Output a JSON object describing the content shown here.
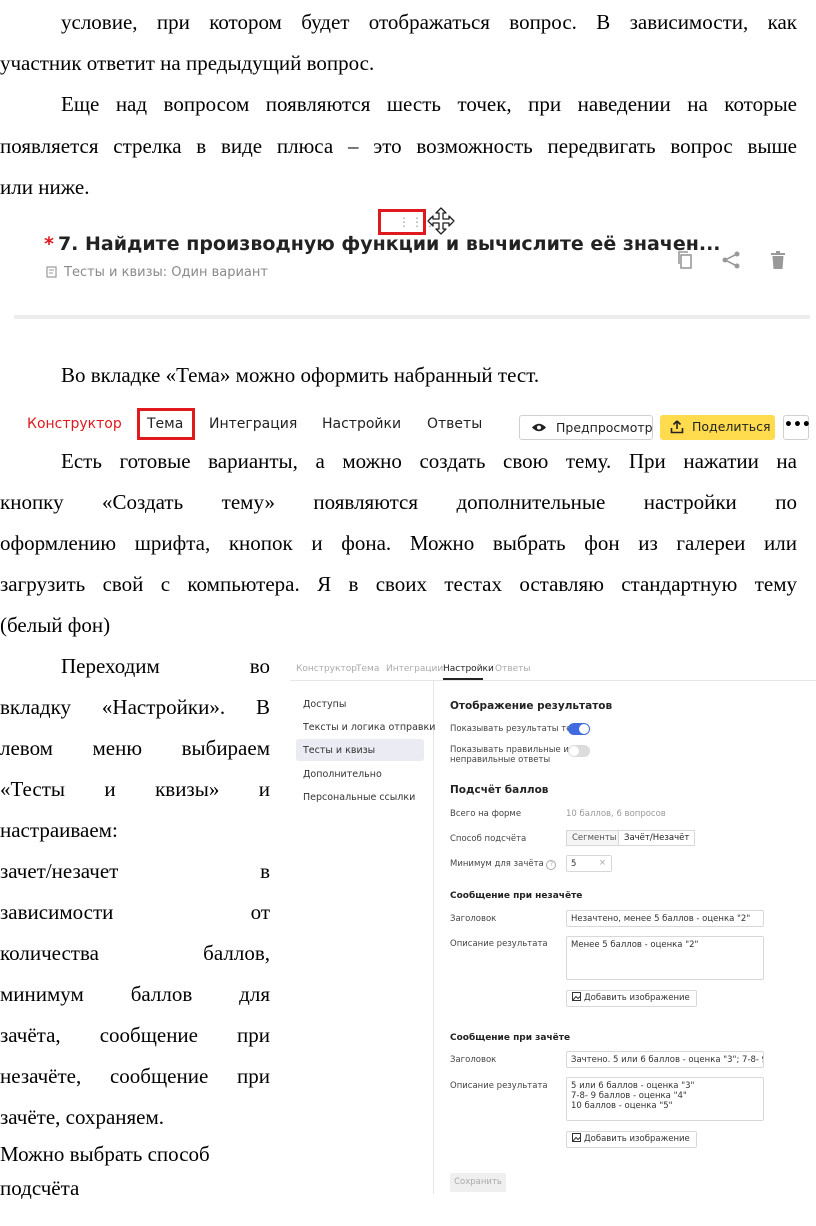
{
  "doc": {
    "para1_line1": "условие, при котором будет отображаться вопрос. В зависимости, как",
    "para1_line2": "участник ответит на предыдущий вопрос.",
    "para2_line1": "Еще над вопросом появляются шесть точек, при наведении на которые",
    "para2_line2": "появляется стрелка в виде плюса – это возможность передвигать вопрос выше",
    "para2_line3": "или ниже.",
    "para3": "Во вкладке «Тема» можно оформить набранный тест.",
    "para4_line1": "Есть готовые варианты, а можно создать свою тему. При нажатии на",
    "para4_line2": "кнопку «Создать тему» появляются дополнительные настройки по",
    "para4_line3": "оформлению шрифта, кнопок и фона. Можно выбрать фон из галереи или",
    "para4_line4": "загрузить свой с компьютера. Я в своих тестах оставляю стандартную тему",
    "para4_line5": "(белый фон)",
    "para5_lines": [
      "Переходим во",
      "вкладку «Настройки». В",
      "левом меню выбираем",
      "«Тесты и квизы» и",
      "настраиваем:",
      "зачет/незачет в",
      "зависимости от",
      "количества баллов,",
      "минимум баллов для",
      "зачёта, сообщение при",
      "незачёте, сообщение при",
      "зачёте, сохраняем."
    ],
    "para6_line1": "Можно выбрать способ",
    "para6_line2": "подсчёта"
  },
  "question_shot": {
    "title": "7. Найдите производную функции и вычислите её значен...",
    "required_mark": "*",
    "subtitle": "Тесты и квизы: Один вариант",
    "drag_dots": "⋮⋮⋮",
    "icons": [
      "copy-icon",
      "share-icon",
      "trash-icon",
      "move-icon"
    ]
  },
  "tabbar": {
    "tabs": [
      "Конструктор",
      "Тема",
      "Интеграция",
      "Настройки",
      "Ответы"
    ],
    "preview_label": "Предпросмотр",
    "share_label": "Поделиться",
    "more_label": "•••",
    "accent": "#e0191f",
    "share_bg": "#ffdb4d"
  },
  "settings": {
    "tabs": [
      "Конструктор",
      "Тема",
      "Интеграции",
      "Настройки",
      "Ответы"
    ],
    "menu": [
      "Доступы",
      "Тексты и логика отправки",
      "Тесты и квизы",
      "Дополнительно",
      "Персональные ссылки"
    ],
    "results_heading": "Отображение результатов",
    "show_results_label": "Показывать результаты теста",
    "show_results_on": true,
    "show_answers_label_1": "Показывать правильные и",
    "show_answers_label_2": "неправильные ответы",
    "show_answers_on": false,
    "score_heading": "Подсчёт баллов",
    "total_label": "Всего на форме",
    "total_value": "10 баллов, 6 вопросов",
    "method_label": "Способ подсчёта",
    "method_options": [
      "Сегменты",
      "Зачёт/Незачёт"
    ],
    "method_selected": "Зачёт/Незачёт",
    "min_label": "Минимум для зачёта",
    "min_value": "5",
    "fail_heading": "Сообщение при незачёте",
    "fail_title_label": "Заголовок",
    "fail_title_value": "Незачтено, менее 5 баллов - оценка \"2\"",
    "fail_desc_label": "Описание результата",
    "fail_desc_value": "Менее 5 баллов - оценка \"2\"",
    "add_image_label": "Добавить изображение",
    "pass_heading": "Сообщение при зачёте",
    "pass_title_label": "Заголовок",
    "pass_title_value": "Зачтено. 5 или 6 баллов - оценка \"3\"; 7-8- 9 баллов - оц",
    "pass_desc_label": "Описание результата",
    "pass_desc_value": "5 или 6 баллов - оценка \"3\"\n7-8- 9 баллов - оценка \"4\"\n10 баллов - оценка \"5\"",
    "save_label": "Сохранить",
    "toggle_on_color": "#3f6ae0"
  }
}
